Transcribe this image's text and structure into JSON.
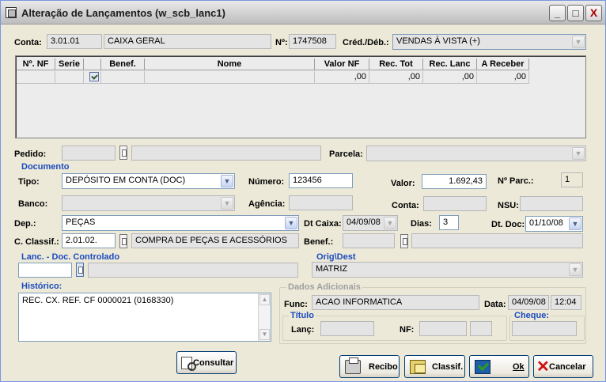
{
  "window": {
    "title": "Alteração de Lançamentos (w_scb_lanc1)",
    "minimize_glyph": "_",
    "maximize_glyph": "□",
    "close_glyph": "X"
  },
  "header": {
    "conta_label": "Conta:",
    "conta_code": "3.01.01",
    "conta_name": "CAIXA GERAL",
    "numero_label": "Nº:",
    "numero_value": "1747508",
    "creddeb_label": "Créd./Déb.:",
    "creddeb_value": "VENDAS À VISTA (+)"
  },
  "grid": {
    "columns": [
      "Nº. NF",
      "Serie",
      "",
      "Benef.",
      "Nome",
      "Valor NF",
      "Rec. Tot",
      "Rec. Lanc",
      "A Receber"
    ],
    "rows": [
      [
        "",
        "",
        "",
        "",
        "",
        ",00",
        ",00",
        ",00",
        ",00"
      ]
    ]
  },
  "pedido": {
    "pedido_label": "Pedido:",
    "parcela_label": "Parcela:"
  },
  "documento": {
    "section_label": "Documento",
    "tipo_label": "Tipo:",
    "tipo_value": "DEPÓSITO EM CONTA (DOC)",
    "numero_label": "Número:",
    "numero_value": "123456",
    "valor_label": "Valor:",
    "valor_value": "1.692,43",
    "nparc_label": "Nº Parc.:",
    "nparc_value": "1",
    "banco_label": "Banco:",
    "agencia_label": "Agência:",
    "conta_label": "Conta:",
    "nsu_label": "NSU:"
  },
  "dep": {
    "dep_label": "Dep.:",
    "dep_value": "PEÇAS",
    "dtcaixa_label": "Dt Caixa:",
    "dtcaixa_value": "04/09/08",
    "dias_label": "Dias:",
    "dias_value": "3",
    "dtdoc_label": "Dt. Doc:",
    "dtdoc_value": "01/10/08",
    "classif_label": "C. Classif.:",
    "classif_code": "2.01.02.",
    "classif_name": "COMPRA DE PEÇAS E ACESSÓRIOS",
    "benef_label": "Benef.:"
  },
  "lanc": {
    "section_label": "Lanc. - Doc. Controlado",
    "orig_label": "Orig\\Dest",
    "orig_value": "MATRIZ"
  },
  "historico": {
    "label": "Histórico:",
    "text": "REC. CX. REF. CF 0000021 (0168330)"
  },
  "adicionais": {
    "section_label": "Dados Adicionais",
    "func_label": "Func:",
    "func_value": "ACAO INFORMATICA",
    "data_label": "Data:",
    "data_value": "04/09/08",
    "hora_value": "12:04",
    "titulo_label": "Título",
    "lanc_label": "Lanç:",
    "nf_label": "NF:",
    "cheque_label": "Cheque:"
  },
  "buttons": {
    "consultar": "Consultar",
    "recibo": "Recibo",
    "classif": "Classif.",
    "ok": "Ok",
    "cancelar": "Cancelar"
  }
}
